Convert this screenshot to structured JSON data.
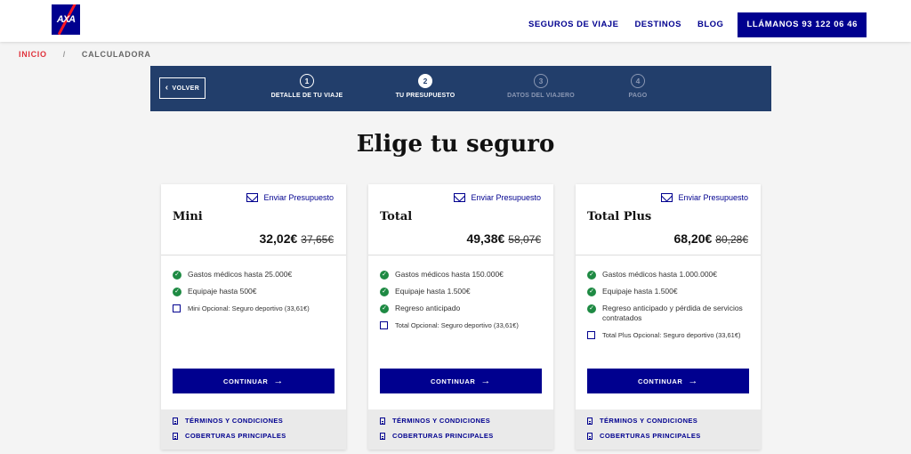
{
  "header": {
    "logo_text": "AXA",
    "nav": [
      "SEGUROS DE VIAJE",
      "DESTINOS",
      "BLOG"
    ],
    "cta": "LLÁMANOS 93 122 06 46"
  },
  "breadcrumb": {
    "home": "INICIO",
    "separator": "/",
    "current": "CALCULADORA"
  },
  "stepper": {
    "back_label": "VOLVER",
    "steps": [
      {
        "number": "1",
        "label": "DETALLE DE TU VIAJE",
        "state": "done"
      },
      {
        "number": "2",
        "label": "TU PRESUPUESTO",
        "state": "current"
      },
      {
        "number": "3",
        "label": "DATOS DEL VIAJERO",
        "state": "pending"
      },
      {
        "number": "4",
        "label": "PAGO",
        "state": "pending"
      }
    ]
  },
  "title": "Elige tu seguro",
  "plans": [
    {
      "send_label": "Enviar Presupuesto",
      "name": "Mini",
      "price": "32,02€",
      "old_price": "37,65€",
      "features": [
        "Gastos médicos hasta 25.000€",
        "Equipaje hasta 500€"
      ],
      "option": "Mini Opcional: Seguro deportivo (33,61€)",
      "continue": "CONTINUAR",
      "links": [
        "TÉRMINOS Y CONDICIONES",
        "COBERTURAS PRINCIPALES"
      ]
    },
    {
      "send_label": "Enviar Presupuesto",
      "name": "Total",
      "price": "49,38€",
      "old_price": "58,07€",
      "features": [
        "Gastos médicos hasta 150.000€",
        "Equipaje hasta 1.500€",
        "Regreso anticipado"
      ],
      "option": "Total Opcional: Seguro deportivo (33,61€)",
      "continue": "CONTINUAR",
      "links": [
        "TÉRMINOS Y CONDICIONES",
        "COBERTURAS PRINCIPALES"
      ]
    },
    {
      "send_label": "Enviar Presupuesto",
      "name": "Total Plus",
      "price": "68,20€",
      "old_price": "80,28€",
      "features": [
        "Gastos médicos hasta 1.000.000€",
        "Equipaje hasta 1.500€",
        "Regreso anticipado y pérdida de servicios contratados"
      ],
      "option": "Total Plus Opcional: Seguro deportivo (33,61€)",
      "continue": "CONTINUAR",
      "links": [
        "TÉRMINOS Y CONDICIONES",
        "COBERTURAS PRINCIPALES"
      ]
    }
  ],
  "colors": {
    "brand": "#00008f",
    "stepper_bg": "#223e6b",
    "check": "#1e8a43",
    "accent_red": "#e0323c"
  },
  "icons": {
    "back": "chevron-left-icon",
    "send": "mail-icon",
    "feature": "check-circle-icon",
    "continue": "arrow-right-icon",
    "link": "document-icon"
  }
}
